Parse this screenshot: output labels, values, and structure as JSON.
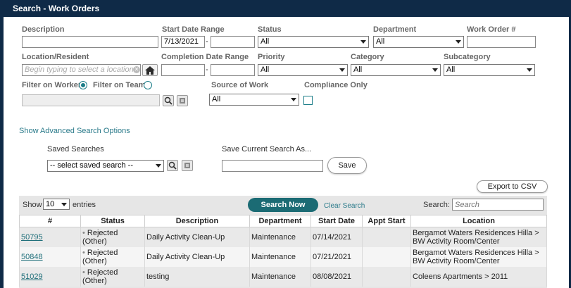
{
  "title": "Search - Work Orders",
  "fields": {
    "description_label": "Description",
    "start_date_label": "Start Date Range",
    "start_date_value": "7/13/2021",
    "status_label": "Status",
    "status_value": "All",
    "department_label": "Department",
    "department_value": "All",
    "work_order_label": "Work Order #",
    "location_label": "Location/Resident",
    "location_placeholder": "Begin typing to select a location",
    "completion_label": "Completion Date Range",
    "priority_label": "Priority",
    "priority_value": "All",
    "category_label": "Category",
    "category_value": "All",
    "subcategory_label": "Subcategory",
    "subcategory_value": "All",
    "filter_worker_label": "Filter on Worker",
    "filter_team_label": "Filter on Team",
    "source_label": "Source of Work",
    "source_value": "All",
    "compliance_label": "Compliance Only"
  },
  "advanced_link": "Show Advanced Search Options",
  "saved": {
    "saved_searches_label": "Saved Searches",
    "saved_select_value": "-- select saved search --",
    "save_current_label": "Save Current Search As...",
    "save_button": "Save"
  },
  "export_button": "Export to CSV",
  "table_controls": {
    "show_label": "Show",
    "entries_value": "10",
    "entries_label": "entries",
    "search_now": "Search Now",
    "clear_search": "Clear Search",
    "search_label": "Search:",
    "search_placeholder": "Search"
  },
  "table": {
    "headers": [
      "#",
      "Status",
      "Description",
      "Department",
      "Start Date",
      "Appt Start",
      "Location"
    ],
    "rows": [
      {
        "id": "50795",
        "status": "Rejected (Other)",
        "description": "Daily Activity Clean-Up",
        "department": "Maintenance",
        "start": "07/14/2021",
        "appt": "",
        "location": "Bergamot Waters Residences Hilla > BW Activity Room/Center"
      },
      {
        "id": "50848",
        "status": "Rejected (Other)",
        "description": "Daily Activity Clean-Up",
        "department": "Maintenance",
        "start": "07/21/2021",
        "appt": "",
        "location": "Bergamot Waters Residences Hilla > BW Activity Room/Center"
      },
      {
        "id": "51029",
        "status": "Rejected (Other)",
        "description": "testing",
        "department": "Maintenance",
        "start": "08/08/2021",
        "appt": "",
        "location": "Coleens Apartments > 2011"
      }
    ]
  },
  "colors": {
    "titlebar": "#0f2a47",
    "accent": "#1b6b74",
    "link": "#2a7a8a"
  }
}
